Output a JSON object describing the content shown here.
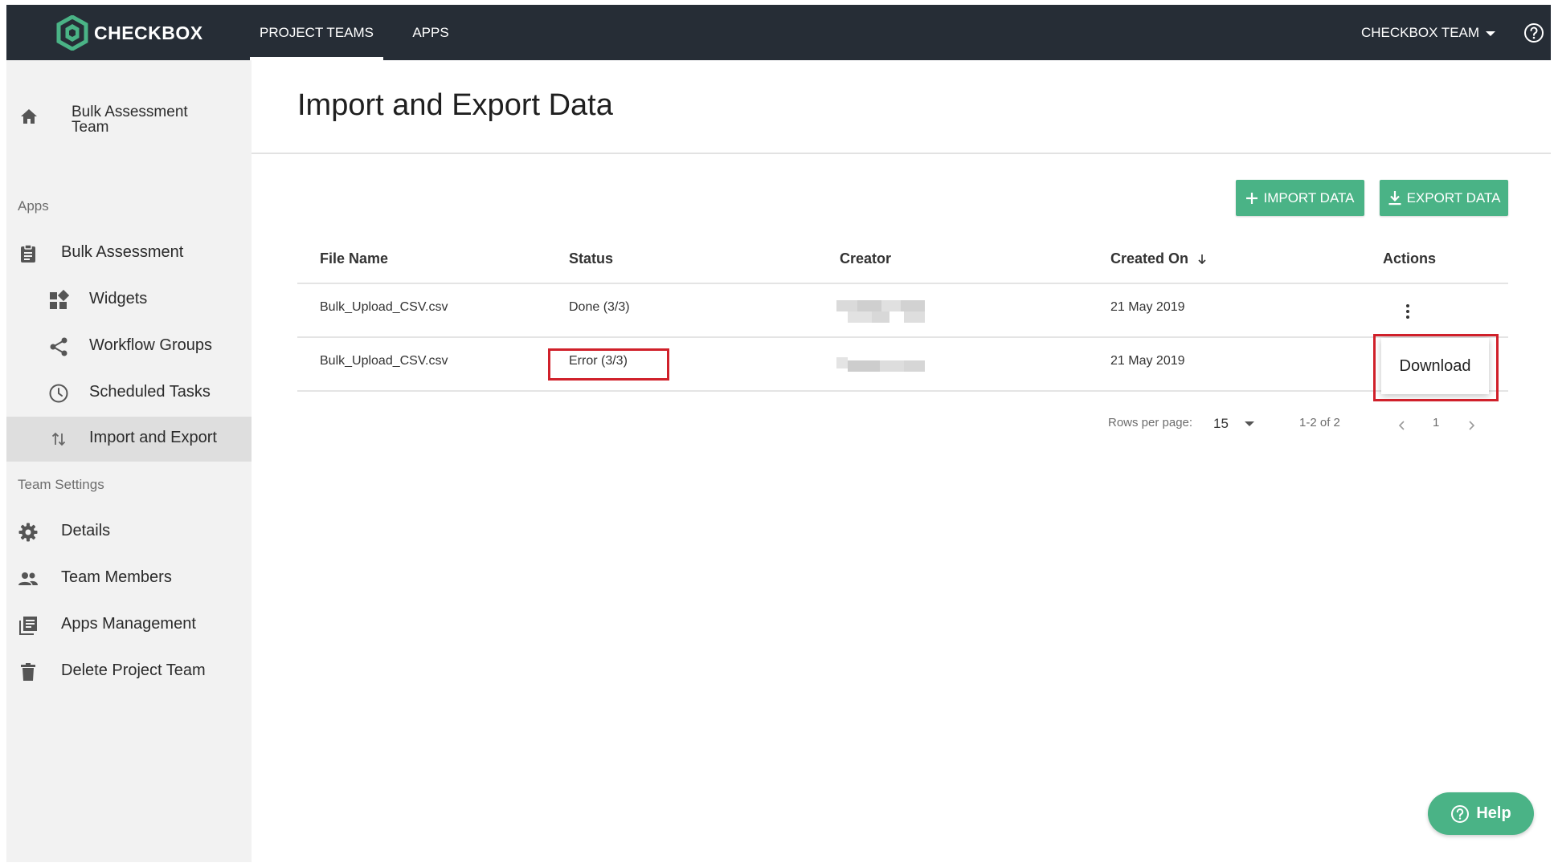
{
  "brand": {
    "name": "CHECKBOX",
    "accent": "#4ab386",
    "nav_bg": "#262d36",
    "highlight": "#d0202a"
  },
  "topnav": {
    "tabs": [
      {
        "label": "PROJECT TEAMS",
        "active": true
      },
      {
        "label": "APPS",
        "active": false
      }
    ],
    "team_menu": "CHECKBOX TEAM",
    "help_icon": "question-circle-icon"
  },
  "sidebar": {
    "team": {
      "label": "Bulk Assessment Team",
      "icon": "home-icon"
    },
    "apps_heading": "Apps",
    "apps": [
      {
        "label": "Bulk Assessment",
        "icon": "clipboard-icon",
        "active": false
      },
      {
        "label": "Widgets",
        "icon": "widgets-icon",
        "active": false
      },
      {
        "label": "Workflow Groups",
        "icon": "share-icon",
        "active": false
      },
      {
        "label": "Scheduled Tasks",
        "icon": "clock-icon",
        "active": false
      },
      {
        "label": "Import and Export",
        "icon": "import-export-icon",
        "active": true
      }
    ],
    "settings_heading": "Team Settings",
    "settings": [
      {
        "label": "Details",
        "icon": "gear-icon"
      },
      {
        "label": "Team Members",
        "icon": "people-icon"
      },
      {
        "label": "Apps Management",
        "icon": "library-icon"
      },
      {
        "label": "Delete Project Team",
        "icon": "trash-icon"
      }
    ]
  },
  "main": {
    "title": "Import and Export Data",
    "import_button": "IMPORT DATA",
    "export_button": "EXPORT DATA",
    "table": {
      "columns": [
        "File Name",
        "Status",
        "Creator",
        "Created On",
        "Actions"
      ],
      "sort_column": "Created On",
      "sort_direction": "descending",
      "rows": [
        {
          "file_name": "Bulk_Upload_CSV.csv",
          "status": "Done (3/3)",
          "creator": "",
          "created_on": "21 May 2019"
        },
        {
          "file_name": "Bulk_Upload_CSV.csv",
          "status": "Error (3/3)",
          "creator": "",
          "created_on": "21 May 2019"
        }
      ]
    },
    "actions_menu": {
      "download_label": "Download"
    },
    "pagination": {
      "rows_per_page_label": "Rows per page:",
      "rows_per_page": "15",
      "range": "1-2 of 2",
      "current_page": "1"
    }
  },
  "help_fab": {
    "label": "Help"
  }
}
